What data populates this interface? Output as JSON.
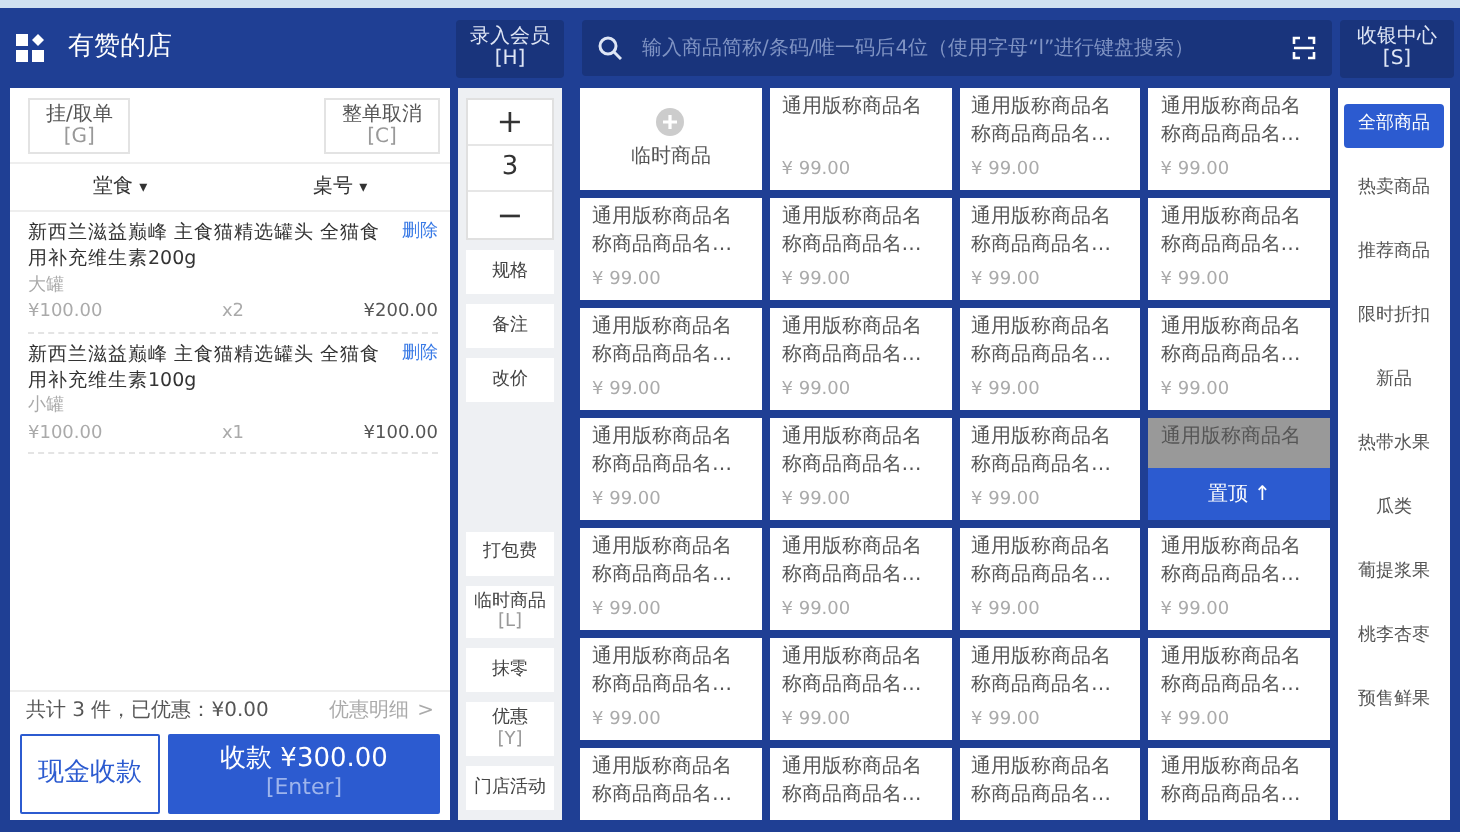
{
  "store": {
    "name": "有赞的店"
  },
  "member_button": {
    "label": "录入会员",
    "key": "[H]"
  },
  "search": {
    "placeholder": "输入商品简称/条码/唯一码后4位（使用字母“l”进行键盘搜索）"
  },
  "cashier_button": {
    "label": "收银中心",
    "key": "[S]"
  },
  "order_actions": [
    {
      "label": "挂/取单",
      "key": "[G]"
    },
    {
      "label": "整单取消",
      "key": "[C]"
    }
  ],
  "dropdowns": [
    {
      "label": "堂食",
      "caret": "▾"
    },
    {
      "label": "桌号",
      "caret": "▾"
    }
  ],
  "order_items": [
    {
      "name": "新西兰滋益巅峰 主食猫精选罐头 全猫食用补充维生素200g",
      "delete": "删除",
      "spec": "大罐",
      "unit_price": "¥100.00",
      "qty": "x2",
      "total": "¥200.00"
    },
    {
      "name": "新西兰滋益巅峰 主食猫精选罐头 全猫食用补充维生素100g",
      "delete": "删除",
      "spec": "小罐",
      "unit_price": "¥100.00",
      "qty": "x1",
      "total": "¥100.00"
    }
  ],
  "summary": {
    "text": "共计 3 件，已优惠：¥0.00",
    "detail_link": "优惠明细",
    "detail_arrow": ">"
  },
  "cash_button": {
    "label": "现金收款"
  },
  "pay_button": {
    "label": "收款 ¥300.00",
    "key": "[Enter]"
  },
  "quantity": {
    "plus": "+",
    "value": "3",
    "minus": "−"
  },
  "side_actions_top": [
    {
      "label": "规格"
    },
    {
      "label": "备注"
    },
    {
      "label": "改价"
    }
  ],
  "side_actions_bottom": [
    {
      "label": "打包费"
    },
    {
      "label": "临时商品",
      "key": "[L]"
    },
    {
      "label": "抹零"
    },
    {
      "label": "优惠",
      "key": "[Y]"
    },
    {
      "label": "门店活动"
    }
  ],
  "temp_product_tile": {
    "label": "临时商品"
  },
  "products": [
    {
      "kind": "product",
      "name_lines": [
        "通用版称商品名"
      ],
      "price": "¥ 99.00"
    },
    {
      "kind": "product",
      "name_lines": [
        "通用版称商品名",
        "称商品商品名…"
      ],
      "price": "¥ 99.00"
    },
    {
      "kind": "product",
      "name_lines": [
        "通用版称商品名",
        "称商品商品名…"
      ],
      "price": "¥ 99.00"
    },
    {
      "kind": "product",
      "name_lines": [
        "通用版称商品名",
        "称商品商品名…"
      ],
      "price": "¥ 99.00"
    },
    {
      "kind": "product",
      "name_lines": [
        "通用版称商品名",
        "称商品商品名…"
      ],
      "price": "¥ 99.00"
    },
    {
      "kind": "product",
      "name_lines": [
        "通用版称商品名",
        "称商品商品名…"
      ],
      "price": "¥ 99.00"
    },
    {
      "kind": "product",
      "name_lines": [
        "通用版称商品名",
        "称商品商品名…"
      ],
      "price": "¥ 99.00"
    },
    {
      "kind": "product",
      "name_lines": [
        "通用版称商品名",
        "称商品商品名…"
      ],
      "price": "¥ 99.00"
    },
    {
      "kind": "product",
      "name_lines": [
        "通用版称商品名",
        "称商品商品名…"
      ],
      "price": "¥ 99.00"
    },
    {
      "kind": "product",
      "name_lines": [
        "通用版称商品名",
        "称商品商品名…"
      ],
      "price": "¥ 99.00"
    },
    {
      "kind": "product",
      "name_lines": [
        "通用版称商品名",
        "称商品商品名…"
      ],
      "price": "¥ 99.00"
    },
    {
      "kind": "product",
      "name_lines": [
        "通用版称商品名",
        "称商品商品名…"
      ],
      "price": "¥ 99.00"
    },
    {
      "kind": "product",
      "name_lines": [
        "通用版称商品名",
        "称商品商品名…"
      ],
      "price": "¥ 99.00"
    },
    {
      "kind": "product",
      "name_lines": [
        "通用版称商品名",
        "称商品商品名…"
      ],
      "price": "¥ 99.00"
    },
    {
      "kind": "pinned",
      "name_lines": [
        "通用版称商品名"
      ],
      "action": "置顶",
      "action_icon": "↑"
    },
    {
      "kind": "product",
      "name_lines": [
        "通用版称商品名",
        "称商品商品名…"
      ],
      "price": "¥ 99.00"
    },
    {
      "kind": "product",
      "name_lines": [
        "通用版称商品名",
        "称商品商品名…"
      ],
      "price": "¥ 99.00"
    },
    {
      "kind": "product",
      "name_lines": [
        "通用版称商品名",
        "称商品商品名…"
      ],
      "price": "¥ 99.00"
    },
    {
      "kind": "product",
      "name_lines": [
        "通用版称商品名",
        "称商品商品名…"
      ],
      "price": "¥ 99.00"
    },
    {
      "kind": "product",
      "name_lines": [
        "通用版称商品名",
        "称商品商品名…"
      ],
      "price": "¥ 99.00"
    },
    {
      "kind": "product",
      "name_lines": [
        "通用版称商品名",
        "称商品商品名…"
      ],
      "price": "¥ 99.00"
    },
    {
      "kind": "product",
      "name_lines": [
        "通用版称商品名",
        "称商品商品名…"
      ],
      "price": "¥ 99.00"
    },
    {
      "kind": "product",
      "name_lines": [
        "通用版称商品名",
        "称商品商品名…"
      ],
      "price": "¥ 99.00"
    },
    {
      "kind": "product",
      "name_lines": [
        "通用版称商品名",
        "称商品商品名…"
      ]
    },
    {
      "kind": "product",
      "name_lines": [
        "通用版称商品名",
        "称商品商品名…"
      ]
    },
    {
      "kind": "product",
      "name_lines": [
        "通用版称商品名",
        "称商品商品名…"
      ]
    },
    {
      "kind": "product",
      "name_lines": [
        "通用版称商品名",
        "称商品商品名…"
      ]
    }
  ],
  "categories": [
    {
      "label": "全部商品",
      "selected": true
    },
    {
      "label": "热卖商品",
      "selected": false
    },
    {
      "label": "推荐商品",
      "selected": false
    },
    {
      "label": "限时折扣",
      "selected": false
    },
    {
      "label": "新品",
      "selected": false
    },
    {
      "label": "热带水果",
      "selected": false
    },
    {
      "label": "瓜类",
      "selected": false
    },
    {
      "label": "葡提浆果",
      "selected": false
    },
    {
      "label": "桃李杏枣",
      "selected": false
    },
    {
      "label": "预售鲜果",
      "selected": false
    }
  ]
}
